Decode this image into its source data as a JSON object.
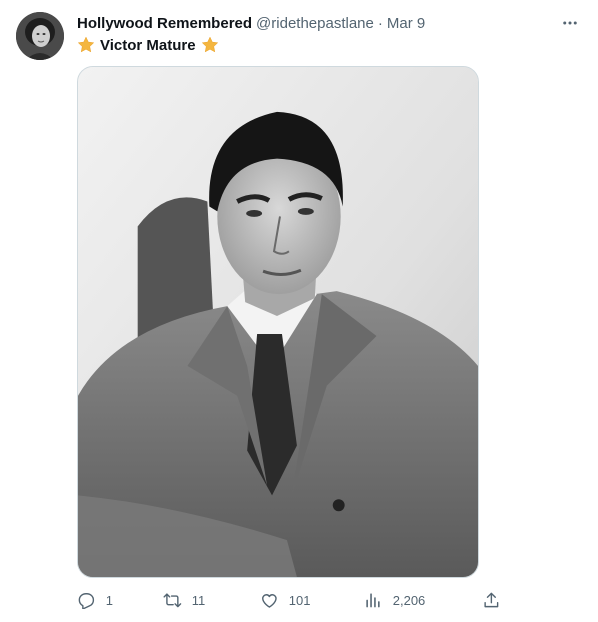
{
  "tweet": {
    "author": {
      "display_name": "Hollywood Remembered",
      "handle": "@ridethepastlane",
      "separator": "·",
      "date": "Mar 9"
    },
    "text": {
      "prefix_emoji": "star",
      "label": "Victor Mature",
      "suffix_emoji": "star"
    },
    "media": {
      "kind": "photo",
      "subject": "black-and-white portrait photo"
    },
    "actions": {
      "replies": "1",
      "retweets": "11",
      "likes": "101",
      "views": "2,206"
    },
    "icons": [
      "more-icon",
      "reply-icon",
      "retweet-icon",
      "like-icon",
      "views-icon",
      "share-icon"
    ],
    "colors": {
      "text_primary": "#0f1419",
      "text_secondary": "#536471",
      "star": "#f4b63f",
      "border": "#cfd9de"
    }
  }
}
